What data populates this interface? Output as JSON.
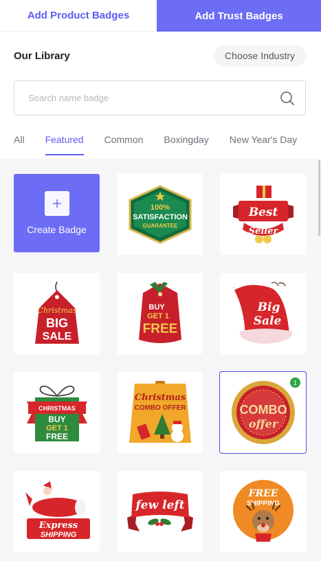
{
  "top_tabs": {
    "product": "Add Product Badges",
    "trust": "Add Trust Badges"
  },
  "library": {
    "title": "Our Library",
    "choose_industry": "Choose Industry"
  },
  "search": {
    "placeholder": "Search name badge",
    "value": ""
  },
  "filters": {
    "items": [
      "All",
      "Featured",
      "Common",
      "Boxingday",
      "New Year's Day"
    ],
    "active": "Featured"
  },
  "grid": {
    "create_label": "Create Badge",
    "selected_count": "1",
    "badges": {
      "satisfaction": {
        "line1": "100%",
        "line2": "SATISFACTION",
        "line3": "GUARANTEE"
      },
      "best_seller": {
        "line1": "Best",
        "line2": "Seller"
      },
      "christmas_big_sale": {
        "line1": "Christmas",
        "line2": "BIG",
        "line3": "SALE"
      },
      "buy_get_free": {
        "line1": "BUY",
        "line2": "GET 1",
        "line3": "FREE"
      },
      "big_sale": {
        "line1": "Big",
        "line2": "Sale"
      },
      "christmas_buy_get_free": {
        "line1": "CHRISTMAS",
        "line2": "BUY",
        "line3": "GET 1",
        "line4": "FREE"
      },
      "christmas_combo": {
        "line1": "Christmas",
        "line2": "COMBO OFFER"
      },
      "combo_offer": {
        "line1": "COMBO",
        "line2": "offer"
      },
      "express_shipping": {
        "line1": "Express",
        "line2": "SHIPPING"
      },
      "few_left": {
        "line1": "few left"
      },
      "free_shipping": {
        "line1": "FREE",
        "line2": "SHIPPING"
      }
    }
  },
  "colors": {
    "accent": "#6c6cf4",
    "accent_text": "#5b5df0",
    "check": "#2ea344"
  }
}
